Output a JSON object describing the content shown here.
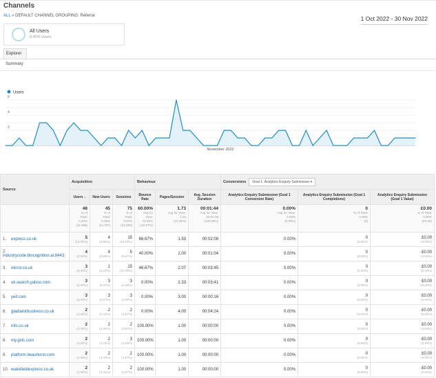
{
  "header": {
    "title": "Channels",
    "breadcrumb_all": "ALL",
    "breadcrumb_sep": " » ",
    "breadcrumb_rest": "DEFAULT CHANNEL GROUPING: Referral",
    "date_range": "1 Oct 2022 - 30 Nov 2022"
  },
  "segment": {
    "name": "All Users",
    "sub": "0.40% Users"
  },
  "tabs": {
    "explorer": "Explorer",
    "summary": "Summary"
  },
  "chart_data": {
    "type": "area",
    "series": [
      {
        "name": "Users",
        "values": [
          0,
          0,
          1,
          0,
          0,
          3,
          3,
          2,
          0,
          2,
          3,
          2,
          2,
          1,
          0,
          1,
          1,
          0,
          2,
          1,
          2,
          0,
          1,
          1,
          1,
          6,
          2,
          2,
          1,
          0,
          0,
          0,
          2,
          2,
          1,
          1,
          0,
          0,
          1,
          1,
          2,
          2,
          0,
          0,
          2,
          0,
          1,
          2,
          0,
          0,
          0,
          1,
          1,
          1,
          2,
          0,
          0,
          1,
          1,
          1,
          1
        ]
      }
    ],
    "x_range": [
      "1 Oct 2022",
      "30 Nov 2022"
    ],
    "x_label": "November 2022",
    "y_ticks": [
      "2",
      "4",
      "6"
    ],
    "ylim": [
      0,
      6.5
    ],
    "grid": true,
    "legend": "top-left",
    "color": "#1f8dc2"
  },
  "table": {
    "source_header": "Source",
    "acq": "Acquisition",
    "beh": "Behaviour",
    "conv": "Conversions",
    "goal_select": "Goal 1: Analytics Enquiry Submission",
    "columns": [
      "Users",
      "New Users",
      "Sessions",
      "Bounce Rate",
      "Pages/Session",
      "Avg. Session Duration",
      "Analytics Enquiry Submission (Goal 1 Conversion Rate)",
      "Analytics Enquiry Submission (Goal 1 Completions)",
      "Analytics Enquiry Submission (Goal 1 Value)"
    ],
    "totals": [
      {
        "v": "48",
        "a": "% of",
        "b": "Total:",
        "c": "0.40%",
        "d": "(11,956)"
      },
      {
        "v": "45",
        "a": "% of",
        "b": "Total:",
        "c": "0.38%",
        "d": "(11,787)"
      },
      {
        "v": "75",
        "a": "% of",
        "b": "Total:",
        "c": "0.57%",
        "d": "(13,260)"
      },
      {
        "v": "60.00%",
        "a": "Avg for",
        "b": "View:",
        "c": "75.82%",
        "d": "(-20.87%)"
      },
      {
        "v": "1.73",
        "a": "Avg for View:",
        "b": "1.02",
        "c": "(70.39%)",
        "d": ""
      },
      {
        "v": "00:01:44",
        "a": "Avg for View:",
        "b": "00:00:39",
        "c": "(165.39%)",
        "d": ""
      },
      {
        "v": "0.00%",
        "a": "Avg for View:",
        "b": "0.00%",
        "c": "(0.00%)",
        "d": ""
      },
      {
        "v": "0",
        "a": "% of Total:",
        "b": "0.00%",
        "c": "(0)",
        "d": ""
      },
      {
        "v": "£0.00",
        "a": "% of Total:",
        "b": "0.00%",
        "c": "(£0.00)",
        "d": ""
      }
    ],
    "rows": [
      {
        "n": "1.",
        "src": "express.co.uk",
        "u": "5",
        "up": "(10.00%)",
        "nu": "4",
        "nup": "(8.89%)",
        "s": "15",
        "sp": "(20.00%)",
        "br": "66.67%",
        "ps": "1.53",
        "d": "00:02:08",
        "cr": "0.00%",
        "c": "0",
        "cp": "(0.00%)",
        "val": "£0.00",
        "vp": "(0.00%)"
      },
      {
        "n": "2.",
        "src": "industrycode.blucognition.ai:8443",
        "u": "4",
        "up": "(8.00%)",
        "nu": "4",
        "nup": "(8.89%)",
        "s": "5",
        "sp": "(6.67%)",
        "br": "40.00%",
        "ps": "2.00",
        "d": "00:01:04",
        "cr": "0.00%",
        "c": "0",
        "cp": "(0.00%)",
        "val": "£0.00",
        "vp": "(0.00%)"
      },
      {
        "n": "3.",
        "src": "mirror.co.uk",
        "u": "3",
        "up": "(6.00%)",
        "nu": "1",
        "nup": "(2.22%)",
        "s": "15",
        "sp": "(20.00%)",
        "br": "46.67%",
        "ps": "2.07",
        "d": "00:03:45",
        "cr": "0.00%",
        "c": "0",
        "cp": "(0.00%)",
        "val": "£0.00",
        "vp": "(0.00%)"
      },
      {
        "n": "4.",
        "src": "uk.search.yahoo.com",
        "u": "3",
        "up": "(6.00%)",
        "nu": "3",
        "nup": "(6.67%)",
        "s": "3",
        "sp": "(4.00%)",
        "br": "0.00%",
        "ps": "2.33",
        "d": "00:03:41",
        "cr": "0.00%",
        "c": "0",
        "cp": "(0.00%)",
        "val": "£0.00",
        "vp": "(0.00%)"
      },
      {
        "n": "5.",
        "src": "yell.com",
        "u": "3",
        "up": "(6.00%)",
        "nu": "3",
        "nup": "(6.67%)",
        "s": "3",
        "sp": "(4.00%)",
        "br": "0.00%",
        "ps": "3.00",
        "d": "00:00:16",
        "cr": "0.00%",
        "c": "0",
        "cp": "(0.00%)",
        "val": "£0.00",
        "vp": "(0.00%)"
      },
      {
        "n": "6.",
        "src": "gladiatorbusiness.co.uk",
        "u": "2",
        "up": "(4.00%)",
        "nu": "2",
        "nup": "(4.44%)",
        "s": "2",
        "sp": "(2.67%)",
        "br": "0.00%",
        "ps": "4.00",
        "d": "00:04:24",
        "cr": "0.00%",
        "c": "0",
        "cp": "(0.00%)",
        "val": "£0.00",
        "vp": "(0.00%)"
      },
      {
        "n": "7.",
        "src": "info.co.uk",
        "u": "2",
        "up": "(4.00%)",
        "nu": "2",
        "nup": "(4.44%)",
        "s": "2",
        "sp": "(2.67%)",
        "br": "100.00%",
        "ps": "1.00",
        "d": "00:00:00",
        "cr": "0.00%",
        "c": "0",
        "cp": "(0.00%)",
        "val": "£0.00",
        "vp": "(0.00%)"
      },
      {
        "n": "8.",
        "src": "my.gvtc.com",
        "u": "2",
        "up": "(4.00%)",
        "nu": "2",
        "nup": "(4.44%)",
        "s": "3",
        "sp": "(4.00%)",
        "br": "100.00%",
        "ps": "1.00",
        "d": "00:00:00",
        "cr": "0.00%",
        "c": "0",
        "cp": "(0.00%)",
        "val": "£0.00",
        "vp": "(0.00%)"
      },
      {
        "n": "9.",
        "src": "platform.beauhurst.com",
        "u": "2",
        "up": "(4.00%)",
        "nu": "2",
        "nup": "(4.44%)",
        "s": "2",
        "sp": "(2.67%)",
        "br": "100.00%",
        "ps": "1.00",
        "d": "00:00:00",
        "cr": "0.00%",
        "c": "0",
        "cp": "(0.00%)",
        "val": "£0.00",
        "vp": "(0.00%)"
      },
      {
        "n": "10.",
        "src": "wakefieldexpress.co.uk",
        "u": "2",
        "up": "(4.00%)",
        "nu": "2",
        "nup": "(4.44%)",
        "s": "2",
        "sp": "(2.67%)",
        "br": "100.00%",
        "ps": "1.00",
        "d": "00:00:00",
        "cr": "0.00%",
        "c": "0",
        "cp": "(0.00%)",
        "val": "£0.00",
        "vp": "(0.00%)"
      }
    ]
  }
}
